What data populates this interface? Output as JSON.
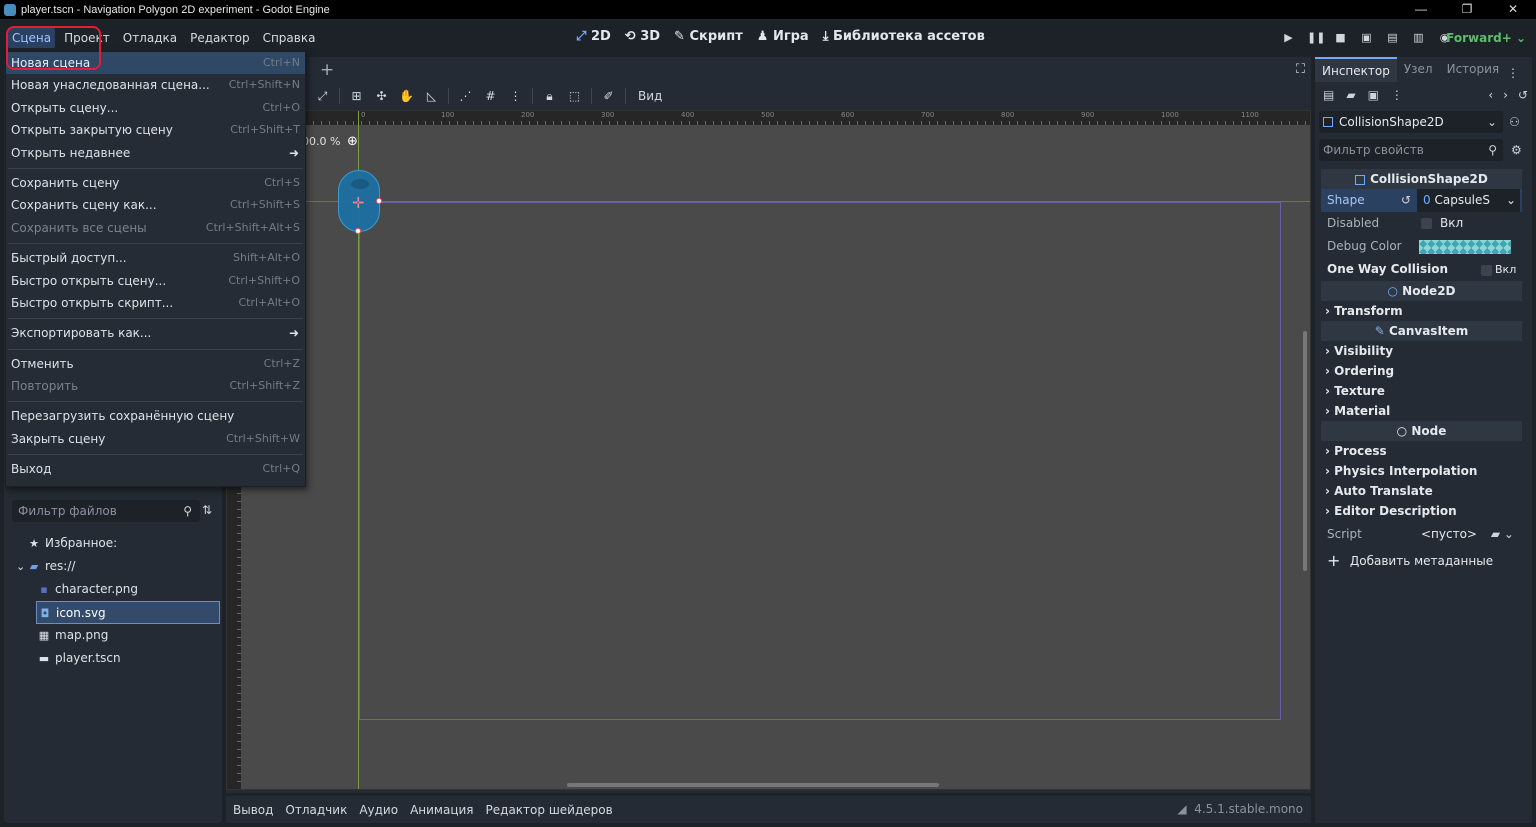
{
  "window": {
    "title": "player.tscn - Navigation Polygon 2D experiment - Godot Engine",
    "controls": [
      "—",
      "❐",
      "✕"
    ]
  },
  "menus": [
    "Сцена",
    "Проект",
    "Отладка",
    "Редактор",
    "Справка"
  ],
  "center_tabs": [
    {
      "icon": "2d-icon",
      "label": "2D"
    },
    {
      "icon": "3d-icon",
      "label": "3D"
    },
    {
      "icon": "script-icon",
      "label": "Скрипт"
    },
    {
      "icon": "game-icon",
      "label": "Игра"
    },
    {
      "icon": "assetlib-icon",
      "label": "Библиотека ассетов"
    }
  ],
  "renderer": "Forward+",
  "scene_menu": {
    "items": [
      {
        "label": "Новая сцена",
        "shortcut": "Ctrl+N",
        "state": "hover"
      },
      {
        "label": "Новая унаследованная сцена...",
        "shortcut": "Ctrl+Shift+N"
      },
      {
        "label": "Открыть сцену...",
        "shortcut": "Ctrl+O"
      },
      {
        "label": "Открыть закрытую сцену",
        "shortcut": "Ctrl+Shift+T"
      },
      {
        "label": "Открыть недавнее",
        "submenu": true
      },
      {
        "separator": true
      },
      {
        "label": "Сохранить сцену",
        "shortcut": "Ctrl+S"
      },
      {
        "label": "Сохранить сцену как...",
        "shortcut": "Ctrl+Shift+S"
      },
      {
        "label": "Сохранить все сцены",
        "shortcut": "Ctrl+Shift+Alt+S",
        "state": "disabled"
      },
      {
        "separator": true
      },
      {
        "label": "Быстрый доступ...",
        "shortcut": "Shift+Alt+O"
      },
      {
        "label": "Быстро открыть сцену...",
        "shortcut": "Ctrl+Shift+O"
      },
      {
        "label": "Быстро открыть скрипт...",
        "shortcut": "Ctrl+Alt+O"
      },
      {
        "separator": true
      },
      {
        "label": "Экспортировать как...",
        "submenu": true
      },
      {
        "separator": true
      },
      {
        "label": "Отменить",
        "shortcut": "Ctrl+Z"
      },
      {
        "label": "Повторить",
        "shortcut": "Ctrl+Shift+Z",
        "state": "disabled"
      },
      {
        "separator": true
      },
      {
        "label": "Перезагрузить сохранённую сцену"
      },
      {
        "label": "Закрыть сцену",
        "shortcut": "Ctrl+Shift+W"
      },
      {
        "separator": true
      },
      {
        "label": "Выход",
        "shortcut": "Ctrl+Q"
      }
    ]
  },
  "filesystem": {
    "filter_placeholder": "Фильтр файлов",
    "items": [
      {
        "label": "Избранное:",
        "icon": "star-icon",
        "indent": 0
      },
      {
        "label": "res://",
        "icon": "folder-icon",
        "indent": 0
      },
      {
        "label": "character.png",
        "icon": "image-icon",
        "indent": 1
      },
      {
        "label": "icon.svg",
        "icon": "svg-icon",
        "indent": 1,
        "selected": true
      },
      {
        "label": "map.png",
        "icon": "image-icon",
        "indent": 1
      },
      {
        "label": "player.tscn",
        "icon": "scene-icon",
        "indent": 1
      }
    ]
  },
  "viewport": {
    "zoom": "00.0 %",
    "view_menu": "Вид",
    "ruler_labels": [
      "0",
      "100",
      "200",
      "300",
      "400",
      "500",
      "600",
      "700",
      "800",
      "900",
      "1000",
      "1100"
    ]
  },
  "bottom_tabs": [
    "Вывод",
    "Отладчик",
    "Аудио",
    "Анимация",
    "Редактор шейдеров"
  ],
  "version": "4.5.1.stable.mono",
  "inspector": {
    "tabs": [
      "Инспектор",
      "Узел",
      "История"
    ],
    "node_name": "CollisionShape2D",
    "filter_placeholder": "Фильтр свойств",
    "section_title": "CollisionShape2D",
    "props": {
      "shape_label": "Shape",
      "shape_value": "CapsuleS",
      "disabled_label": "Disabled",
      "disabled_value": "Вкл",
      "debug_color_label": "Debug Color",
      "debug_color": "#8fd6d6",
      "one_way_label": "One Way Collision",
      "one_way_value": "Вкл"
    },
    "node2d_title": "Node2D",
    "transform": "Transform",
    "canvasitem_title": "CanvasItem",
    "canvas_groups": [
      "Visibility",
      "Ordering",
      "Texture",
      "Material"
    ],
    "node_title": "Node",
    "node_groups": [
      "Process",
      "Physics Interpolation",
      "Auto Translate",
      "Editor Description"
    ],
    "script_label": "Script",
    "script_value": "<пусто>",
    "add_metadata": "Добавить метаданные"
  }
}
